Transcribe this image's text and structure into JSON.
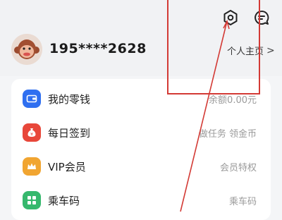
{
  "header": {
    "settings_icon": "gear-icon",
    "message_icon": "chat-message-icon",
    "phone": "195****2628",
    "profile_link": "个人主页",
    "profile_chevron": ">"
  },
  "menu": {
    "items": [
      {
        "label": "我的零钱",
        "right": "余额0.00元",
        "icon": "wallet-icon",
        "color": "#2f6ff0"
      },
      {
        "label": "每日签到",
        "right": "做任务 领金币",
        "icon": "money-bag-icon",
        "color": "#e8473a"
      },
      {
        "label": "VIP会员",
        "right": "会员特权",
        "icon": "crown-icon",
        "color": "#f1a531"
      },
      {
        "label": "乘车码",
        "right": "乘车码",
        "icon": "grid-code-icon",
        "color": "#36b86d"
      }
    ]
  },
  "annotation": {
    "color": "#d33a35"
  }
}
